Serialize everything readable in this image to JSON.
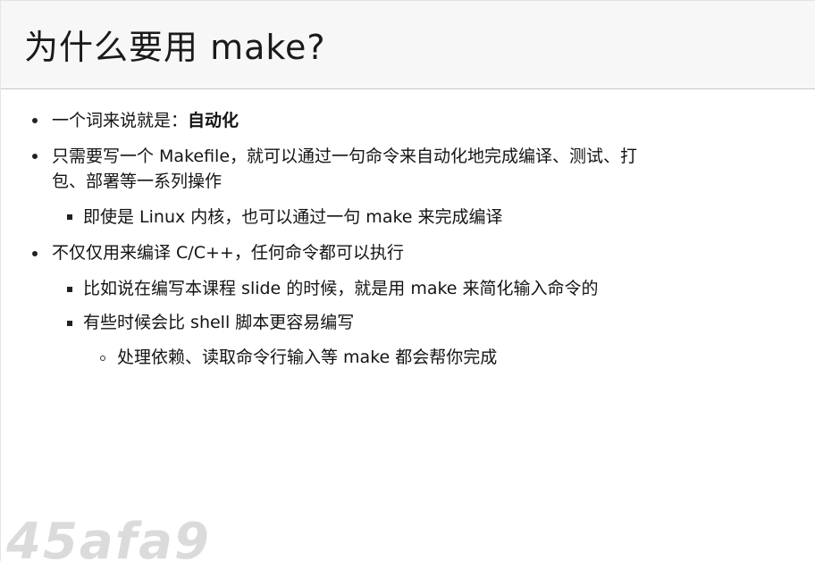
{
  "slide": {
    "title": "为什么要用 make?",
    "items": [
      {
        "level": 1,
        "prefix": "一个词来说就是：",
        "emphasis": "自动化"
      },
      {
        "level": 1,
        "line1": "只需要写一个 Makefile，就可以通过一句命令来自动化地完成编译、测试、打",
        "line2": "包、部署等一系列操作"
      },
      {
        "level": 2,
        "text": "即使是 Linux 内核，也可以通过一句 make 来完成编译"
      },
      {
        "level": 1,
        "text": "不仅仅用来编译 C/C++，任何命令都可以执行"
      },
      {
        "level": 2,
        "text": "比如说在编写本课程 slide 的时候，就是用 make 来简化输入命令的"
      },
      {
        "level": 2,
        "text": "有些时候会比 shell 脚本更容易编写"
      },
      {
        "level": 3,
        "text": "处理依赖、读取命令行输入等 make 都会帮你完成"
      }
    ],
    "watermark": "45afa9"
  }
}
